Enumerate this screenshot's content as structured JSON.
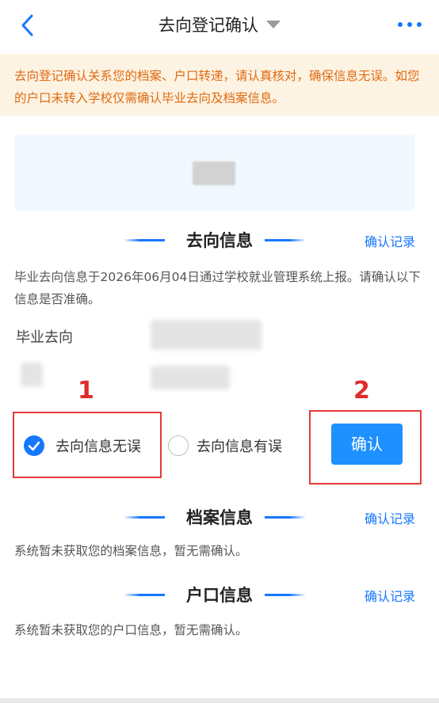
{
  "header": {
    "title": "去向登记确认"
  },
  "notice": "去向登记确认关系您的档案、户口转递，请认真核对，确保信息无误。如您的户口未转入学校仅需确认毕业去向及档案信息。",
  "destination": {
    "title": "去向信息",
    "record_link": "确认记录",
    "desc": "毕业去向信息于2026年06月04日通过学校就业管理系统上报。请确认以下信息是否准确。",
    "field_label": "毕业去向",
    "option_correct": "去向信息无误",
    "option_wrong": "去向信息有误",
    "confirm_label": "确认",
    "marker_1": "1",
    "marker_2": "2"
  },
  "archive": {
    "title": "档案信息",
    "record_link": "确认记录",
    "desc": "系统暂未获取您的档案信息，暂无需确认。"
  },
  "hukou": {
    "title": "户口信息",
    "record_link": "确认记录",
    "desc": "系统暂未获取您的户口信息，暂无需确认。"
  },
  "colors": {
    "accent": "#1677ff",
    "notice_text": "#e06a10",
    "notice_bg": "#fdf3e3",
    "annotation_red": "#e33a3a"
  },
  "icons": {
    "back": "chevron-left-icon",
    "dropdown": "caret-down-icon",
    "more": "more-dots-icon",
    "check": "check-icon"
  }
}
